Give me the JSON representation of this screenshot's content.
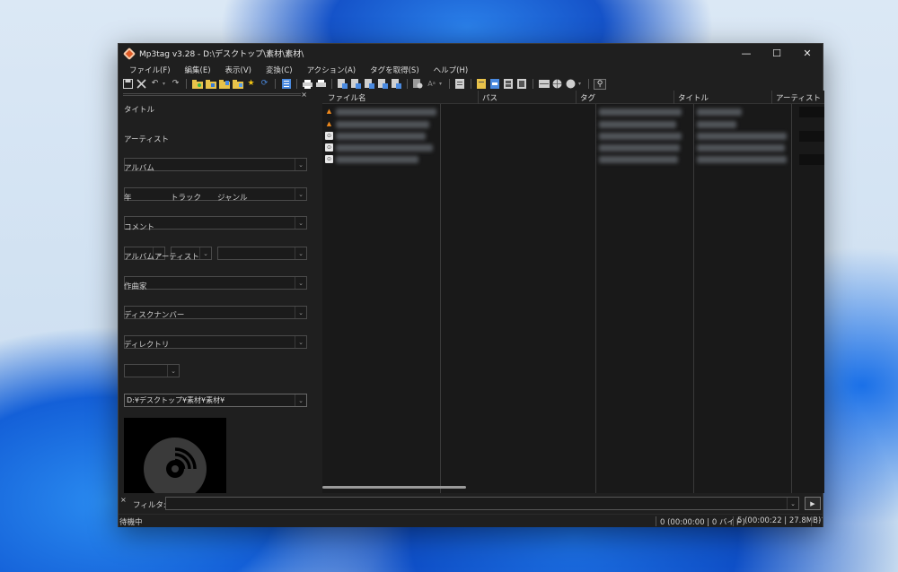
{
  "window": {
    "title": "Mp3tag v3.28  -  D:\\デスクトップ\\素材\\素材\\",
    "controls": {
      "minimize": "—",
      "maximize": "☐",
      "close": "✕"
    }
  },
  "menu": [
    "ファイル(F)",
    "編集(E)",
    "表示(V)",
    "変換(C)",
    "アクション(A)",
    "タグを取得(S)",
    "ヘルプ(H)"
  ],
  "tag_panel": {
    "close": "×",
    "title_label": "タイトル",
    "artist_label": "アーティスト",
    "album_label": "アルバム",
    "year_label": "年",
    "track_label": "トラック",
    "genre_label": "ジャンル",
    "comment_label": "コメント",
    "album_artist_label": "アルバムアーティスト",
    "composer_label": "作曲家",
    "disc_number_label": "ディスクナンバー",
    "directory_label": "ディレクトリ",
    "directory_value": "D:¥デスクトップ¥素材¥素材¥"
  },
  "file_list": {
    "columns": [
      "ファイル名",
      "パス",
      "タグ",
      "タイトル",
      "アーティスト"
    ],
    "rows": [
      {
        "type": "vlc"
      },
      {
        "type": "vlc"
      },
      {
        "type": "file"
      },
      {
        "type": "file"
      },
      {
        "type": "file"
      }
    ]
  },
  "filter": {
    "close": "×",
    "label": "フィルタ:",
    "value": ""
  },
  "status": {
    "left": "待機中",
    "selected": "0 (00:00:00 | 0 バイト)",
    "total": "5 (00:00:22 | 27.8MB)"
  },
  "icons": [
    "save-icon",
    "delete-icon",
    "undo-icon",
    "redo-icon",
    "folder-icon",
    "star-icon",
    "refresh-icon",
    "search-icon",
    "cd-icon"
  ]
}
